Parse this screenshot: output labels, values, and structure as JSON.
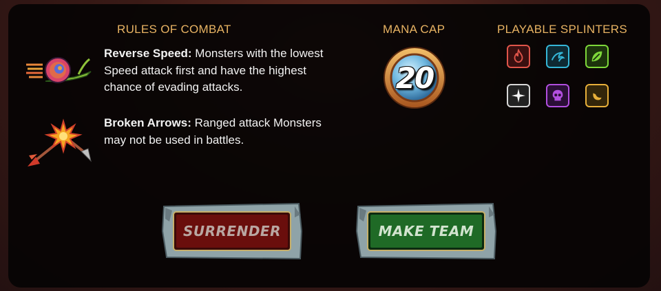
{
  "rules": {
    "heading": "RULES OF COMBAT",
    "items": [
      {
        "name": "Reverse Speed:",
        "description": " Monsters with the lowest Speed attack first and have the highest chance of evading attacks.",
        "icon": "snail-icon"
      },
      {
        "name": "Broken Arrows:",
        "description": " Ranged attack Monsters may not be used in battles.",
        "icon": "broken-arrows-icon"
      }
    ]
  },
  "mana": {
    "heading": "MANA CAP",
    "value": "20"
  },
  "splinters": {
    "heading": "PLAYABLE SPLINTERS",
    "items": [
      {
        "name": "fire",
        "icon": "flame-icon",
        "color": "#e0554a"
      },
      {
        "name": "water",
        "icon": "wave-icon",
        "color": "#35b7d8"
      },
      {
        "name": "earth",
        "icon": "leaf-icon",
        "color": "#7ed83a"
      },
      {
        "name": "life",
        "icon": "sparkle-icon",
        "color": "#d8d8d8"
      },
      {
        "name": "death",
        "icon": "skull-icon",
        "color": "#b24fe0"
      },
      {
        "name": "dragon",
        "icon": "dragon-icon",
        "color": "#e8b03a"
      }
    ]
  },
  "buttons": {
    "surrender": "SURRENDER",
    "make_team": "MAKE TEAM"
  }
}
